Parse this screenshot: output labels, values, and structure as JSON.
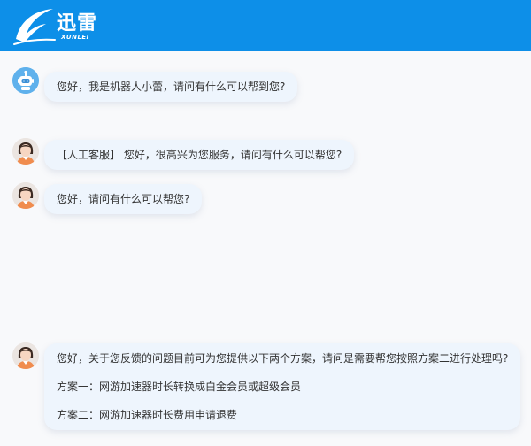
{
  "header": {
    "brand_name": "迅雷",
    "brand_sub": "XUNLEI",
    "bg_color": "#0d8fe8"
  },
  "messages": [
    {
      "avatar": "robot-avatar",
      "text": "您好，我是机器人小蕾，请问有什么可以帮到您?"
    },
    {
      "avatar": "agent-avatar",
      "text": "【人工客服】 您好，很高兴为您服务，请问有什么可以帮您?"
    },
    {
      "avatar": "agent-avatar",
      "text": "您好，请问有什么可以帮您?"
    },
    {
      "avatar": "agent-avatar",
      "lines": [
        "您好，关于您反馈的问题目前可为您提供以下两个方案，请问是需要帮您按照方案二进行处理吗?",
        "方案一：网游加速器时长转换成白金会员或超级会员",
        "方案二：网游加速器时长费用申请退费"
      ]
    }
  ]
}
